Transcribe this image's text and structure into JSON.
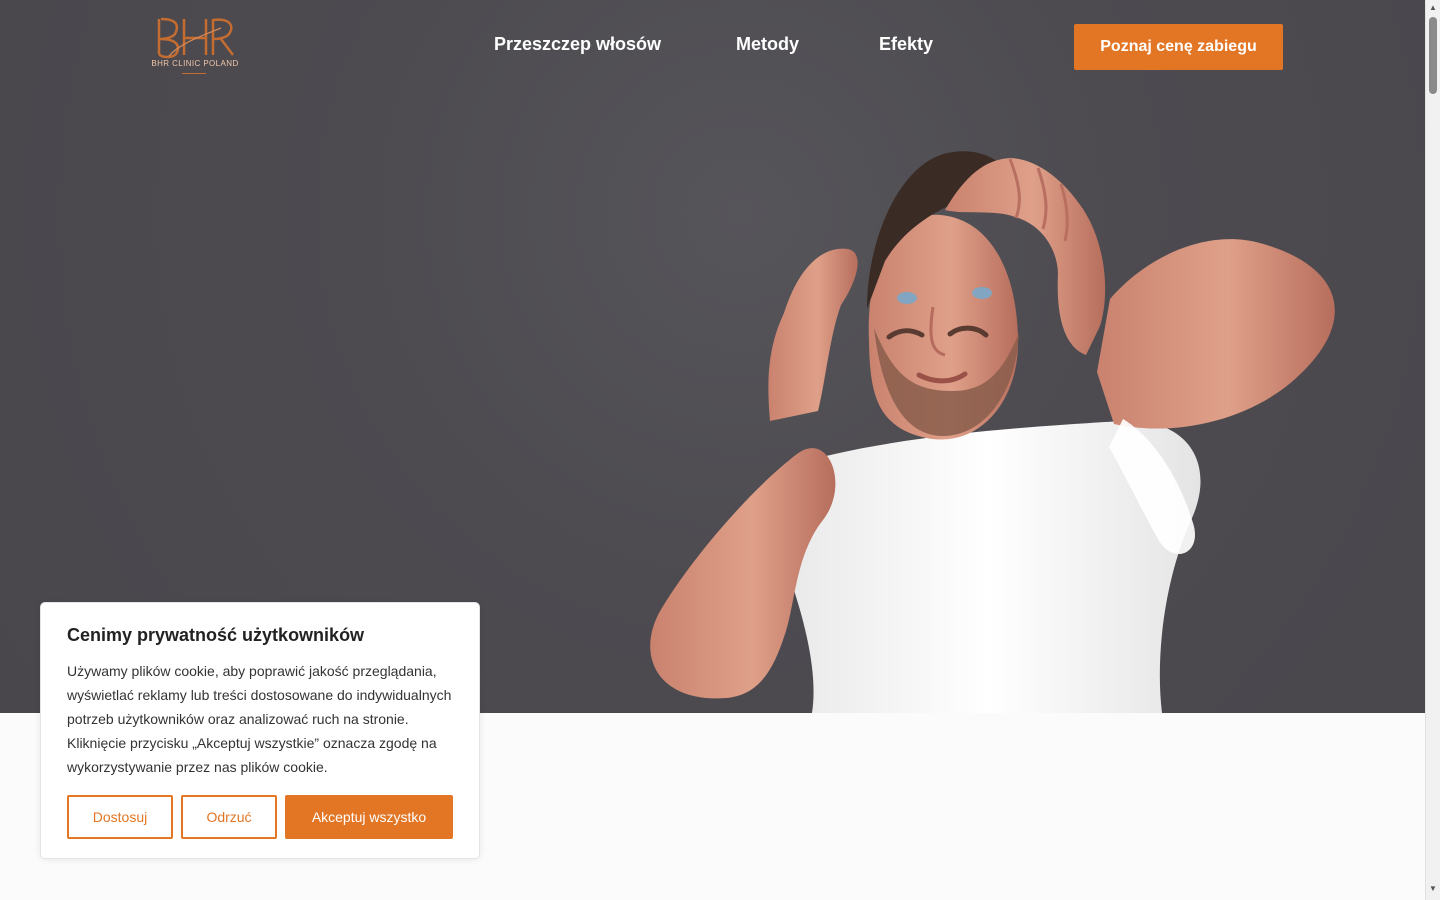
{
  "brand": {
    "logo_text": "BHR CLINIC POLAND",
    "primary_color": "#e37625",
    "logo_color": "#c56d31"
  },
  "nav": {
    "items": [
      "Przeszczep włosów",
      "Metody",
      "Efekty"
    ],
    "cta_label": "Poznaj cenę zabiegu"
  },
  "hero": {
    "background_color": "#4d4b50",
    "image_subject": "man touching hairline"
  },
  "cookie": {
    "title": "Cenimy prywatność użytkowników",
    "text": "Używamy plików cookie, aby poprawić jakość przeglądania, wyświetlać reklamy lub treści dostosowane do indywidualnych potrzeb użytkowników oraz analizować ruch na stronie. Kliknięcie przycisku „Akceptuj wszystkie” oznacza zgodę na wykorzystywanie przez nas plików cookie.",
    "customize_label": "Dostosuj",
    "reject_label": "Odrzuć",
    "accept_label": "Akceptuj wszystko"
  },
  "icons": {
    "scroll_up": "chevron-up-icon",
    "scroll_down": "chevron-down-icon"
  }
}
